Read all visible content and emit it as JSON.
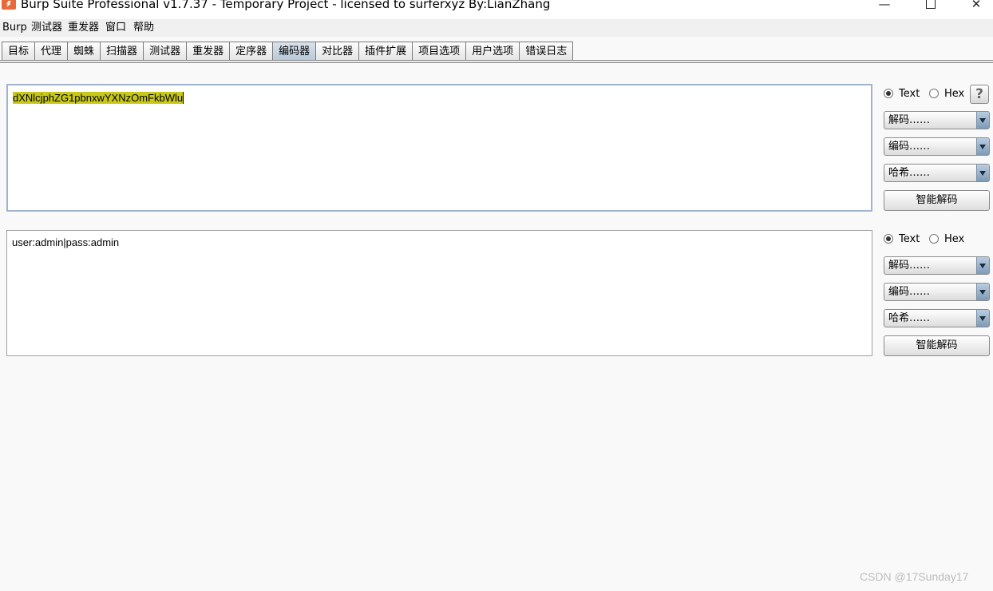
{
  "window": {
    "title": "Burp Suite Professional v1.7.37 - Temporary Project - licensed to surferxyz By:LianZhang",
    "minimize": "—",
    "close": "✕"
  },
  "menubar": [
    "Burp",
    "测试器",
    "重发器",
    "窗口",
    "帮助"
  ],
  "tabs": [
    "目标",
    "代理",
    "蜘蛛",
    "扫描器",
    "测试器",
    "重发器",
    "定序器",
    "编码器",
    "对比器",
    "插件扩展",
    "项目选项",
    "用户选项",
    "错误日志"
  ],
  "active_tab": "编码器",
  "panels": [
    {
      "content": "dXNlcjphZG1pbnxwYXNzOmFkbWlu",
      "selected": true,
      "mode": "Text",
      "radio_text": "Text",
      "radio_hex": "Hex",
      "decode_label": "解码……",
      "encode_label": "编码……",
      "hash_label": "哈希……",
      "smart_decode": "智能解码"
    },
    {
      "content": "user:admin|pass:admin",
      "selected": false,
      "mode": "Text",
      "radio_text": "Text",
      "radio_hex": "Hex",
      "decode_label": "解码……",
      "encode_label": "编码……",
      "hash_label": "哈希……",
      "smart_decode": "智能解码"
    }
  ],
  "help_label": "?",
  "watermark": "CSDN @17Sunday17",
  "colors": {
    "selection_highlight": "#c8c81a",
    "active_tab": "#c4d2e0",
    "focus_border": "#9fb4cc"
  }
}
